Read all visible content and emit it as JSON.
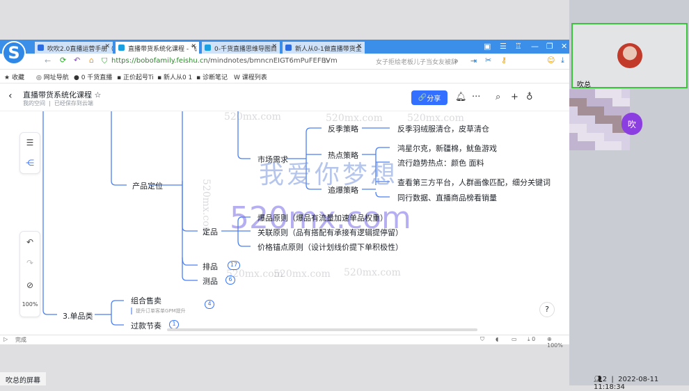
{
  "browser": {
    "tabs": [
      {
        "label": "吹吹2.0直播运营手册（"
      },
      {
        "label": "直播带货系统化课程 - 飞"
      },
      {
        "label": "0-千货直播思维导图目"
      },
      {
        "label": "新人从0-1做直播带货全"
      }
    ],
    "url_host": "https://bobofamily.feishu.cn",
    "url_path": "/mindnotes/bmncnEIGT6mPuFEFBVm",
    "search_placeholder": "女子拒绘老板儿子当女友被辞",
    "bookmarks": [
      "收藏",
      "网址导航",
      "0 千货直播",
      "正价起号Ti",
      "新人从0 1",
      "诊断笔记",
      "课程列表"
    ],
    "status_left": "完成",
    "zoom": "100%",
    "download_count": "0"
  },
  "doc": {
    "title": "直播带货系统化课程",
    "breadcrumb": "我的空间",
    "saved": "已经保存到云端",
    "share_label": "分享"
  },
  "mindmap": {
    "n_product": "产品定位",
    "n_market": "市场需求",
    "n_anti": "反季策略",
    "n_hot": "热点策略",
    "n_chase": "追爆策略",
    "l_anti": "反季羽绒服清仓，皮草清仓",
    "l_hot1": "鸿星尔克，新疆棉，鱿鱼游戏",
    "l_hot2": "流行趋势热点：颜色 面料",
    "l_chase1": "查看第三方平台，人群画像匹配，细分关键词",
    "l_chase2": "同行数据、直播商品榜看销量",
    "n_ding": "定品",
    "d1": "爆品原则（爆品有流量加速单品权重）",
    "d2": "关联原则（品有搭配有承接有逻辑提停留）",
    "d3": "价格锚点原则（设计划线价提下单积极性）",
    "n_pai": "排品",
    "pai_count": "17",
    "n_ce": "测品",
    "ce_count": "6",
    "n_single": "3.单品类",
    "n_combo": "组合售卖",
    "combo_note": "提升订单客单GPM提升",
    "combo_count": "4",
    "n_rhythm": "过款节奏",
    "rhythm_count": "1"
  },
  "toolbar": {
    "zoom": "100%"
  },
  "watermark": {
    "text": "520mx.com",
    "big": "我爱你梦想"
  },
  "meeting": {
    "participant": "吹总",
    "avatar_letter": "吹",
    "screen_label": "吹总的屏幕",
    "count": "2",
    "datetime": "2022-08-11 11:18:34"
  }
}
